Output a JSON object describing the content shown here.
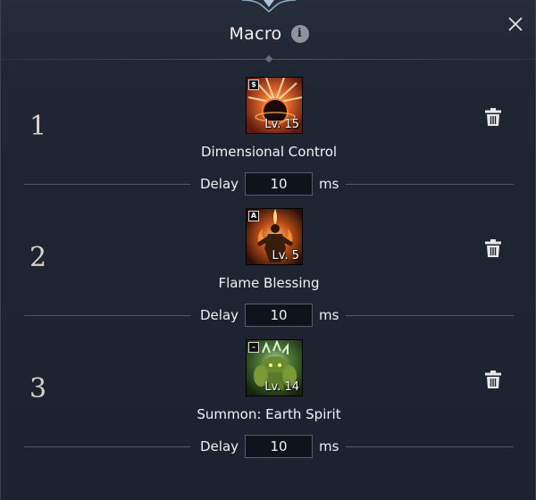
{
  "header": {
    "title": "Macro",
    "info_icon": "info-icon",
    "close_icon": "close-icon"
  },
  "entries": [
    {
      "number": "1",
      "skill_name": "Dimensional Control",
      "level": "Lv. 15",
      "badge": "$",
      "delay_label": "Delay",
      "delay_value": "10",
      "unit": "ms",
      "icon": "dark-orb-icon",
      "delete_icon": "trash-icon"
    },
    {
      "number": "2",
      "skill_name": "Flame Blessing",
      "level": "Lv. 5",
      "badge": "A",
      "delay_label": "Delay",
      "delay_value": "10",
      "unit": "ms",
      "icon": "flame-figure-icon",
      "delete_icon": "trash-icon"
    },
    {
      "number": "3",
      "skill_name": "Summon: Earth Spirit",
      "level": "Lv. 14",
      "badge": "–",
      "delay_label": "Delay",
      "delay_value": "10",
      "unit": "ms",
      "icon": "earth-spirit-icon",
      "delete_icon": "trash-icon"
    }
  ],
  "colors": {
    "background": "#1d2330",
    "input_background": "#0f131b",
    "text": "#f0f0f0"
  }
}
